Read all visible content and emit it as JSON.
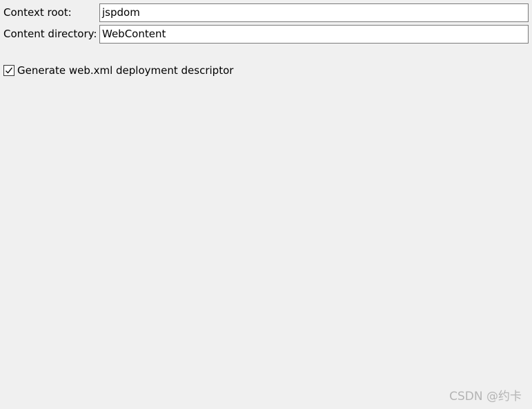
{
  "form": {
    "context_root": {
      "label": "Context root:",
      "value": "jspdom"
    },
    "content_directory": {
      "label": "Content directory:",
      "value": "WebContent"
    },
    "generate_web_xml": {
      "label": "Generate web.xml deployment descriptor",
      "checked": true
    }
  },
  "watermark": "CSDN @约卡",
  "colors": {
    "background": "#f0f0f0",
    "input_border": "#7a7a7a",
    "input_background": "#ffffff",
    "watermark": "#b4b4b4"
  }
}
